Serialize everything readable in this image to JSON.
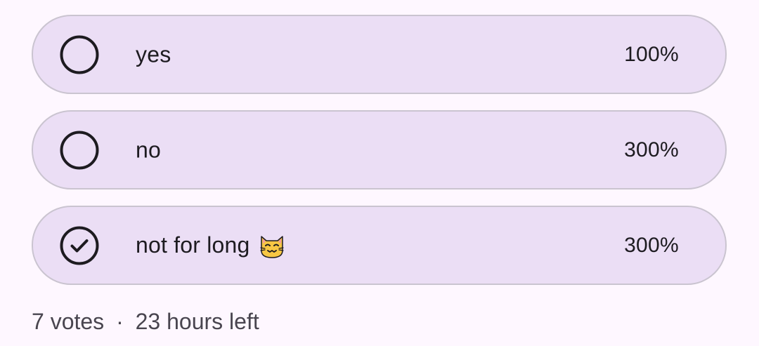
{
  "poll": {
    "options": [
      {
        "label": "yes",
        "percent": "100%",
        "selected": false
      },
      {
        "label": "no",
        "percent": "300%",
        "selected": false
      },
      {
        "label": "not for long",
        "emoji": "cat-face-emoji",
        "percent": "300%",
        "selected": true
      }
    ],
    "votes": "7 votes",
    "separator": "·",
    "time_left": "23 hours left"
  },
  "colors": {
    "option_background": "#ebdef5",
    "option_border": "#cac4d0",
    "text": "#1d1b20",
    "meta_text": "#49454f",
    "page_background": "#fef7ff"
  }
}
